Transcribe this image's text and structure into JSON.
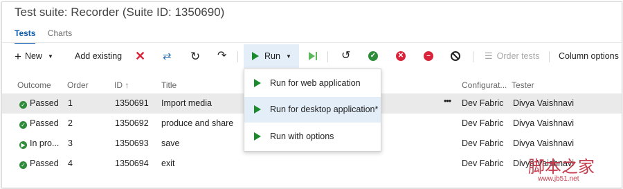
{
  "page": {
    "title": "Test suite: Recorder (Suite ID: 1350690)"
  },
  "tabs": [
    {
      "label": "Tests"
    },
    {
      "label": "Charts"
    }
  ],
  "toolbar": {
    "new_label": "New",
    "add_existing_label": "Add existing",
    "run_label": "Run",
    "order_tests_label": "Order tests",
    "column_options_label": "Column options"
  },
  "grid": {
    "headers": {
      "outcome": "Outcome",
      "order": "Order",
      "id": "ID",
      "title": "Title",
      "configuration": "Configurat...",
      "tester": "Tester"
    },
    "rows": [
      {
        "outcome": "Passed",
        "order": "1",
        "id": "1350691",
        "title": "Import media",
        "configuration": "Dev Fabric",
        "tester": "Divya Vaishnavi"
      },
      {
        "outcome": "Passed",
        "order": "2",
        "id": "1350692",
        "title": "produce and share",
        "configuration": "Dev Fabric",
        "tester": "Divya Vaishnavi"
      },
      {
        "outcome": "In pro...",
        "order": "3",
        "id": "1350693",
        "title": "save",
        "configuration": "Dev Fabric",
        "tester": "Divya Vaishnavi"
      },
      {
        "outcome": "Passed",
        "order": "4",
        "id": "1350694",
        "title": "exit",
        "configuration": "Dev Fabric",
        "tester": "Divya Vaishnavi"
      }
    ],
    "row_more": "•••"
  },
  "run_menu": {
    "items": [
      {
        "label": "Run for web application"
      },
      {
        "label": "Run for desktop application*"
      },
      {
        "label": "Run with options"
      }
    ]
  },
  "watermark": {
    "text": "脚本之家",
    "url": "www.jb51.net"
  },
  "colors": {
    "accent": "#0b5cad",
    "pass": "#2e8b3a",
    "fail": "#d9233a",
    "run_hover": "#e3eef9"
  }
}
